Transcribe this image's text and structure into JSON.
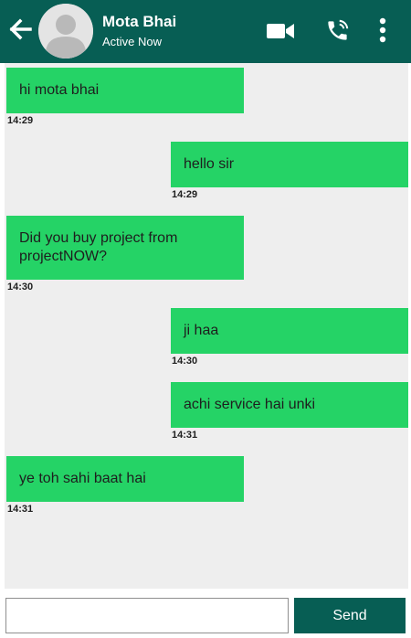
{
  "header": {
    "contact_name": "Mota Bhai",
    "status": "Active Now",
    "back_icon": "arrow-left-icon",
    "video_icon": "video-camera-icon",
    "phone_icon": "phone-icon",
    "more_icon": "more-vertical-icon"
  },
  "messages": [
    {
      "direction": "received",
      "text": "hi mota bhai",
      "time": "14:29"
    },
    {
      "direction": "sent",
      "text": "hello sir",
      "time": "14:29"
    },
    {
      "direction": "received",
      "text": "Did you buy project from projectNOW?",
      "time": "14:30"
    },
    {
      "direction": "sent",
      "text": "ji haa",
      "time": "14:30"
    },
    {
      "direction": "sent",
      "text": "achi service hai unki",
      "time": "14:31"
    },
    {
      "direction": "received",
      "text": "ye toh sahi baat hai",
      "time": "14:31"
    }
  ],
  "composer": {
    "input_value": "",
    "send_label": "Send"
  },
  "colors": {
    "header": "#075e54",
    "bubble": "#25d366",
    "chat_background": "#eeeeee"
  }
}
